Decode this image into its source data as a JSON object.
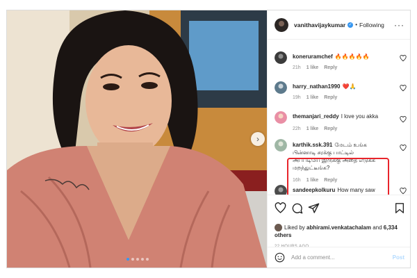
{
  "post": {
    "username": "vanithavijaykumar",
    "verified_mark": "✓",
    "separator": "•",
    "follow_status": "Following",
    "more_glyph": "···",
    "next_glyph": "›"
  },
  "comments": [
    {
      "username": "koneruramchef",
      "text": "🔥🔥🔥🔥🔥",
      "time": "21h",
      "likes": "1 like",
      "reply": "Reply"
    },
    {
      "username": "harry_nathan1990",
      "text": "❤️🙏",
      "time": "19h",
      "likes": "1 like",
      "reply": "Reply"
    },
    {
      "username": "themanjari_reddy",
      "text": "I love you akka",
      "time": "22h",
      "likes": "1 like",
      "reply": "Reply"
    },
    {
      "username": "karthik.ssk.391",
      "text": "மேடம் உங்க பின்னாடி சரக்கு பாட்டில் அப்படியே இருக்கு அதை எடுக்க மறந்துட்டீங்க?",
      "time": "16h",
      "likes": "1 like",
      "reply": "Reply"
    },
    {
      "username": "sandeepkolkuru",
      "text": "How many saw",
      "time": "",
      "likes": "",
      "reply": ""
    }
  ],
  "likes_info": {
    "prefix": "Liked by",
    "liker": "abhirami.venkatachalam",
    "and": "and",
    "others": "6,334 others"
  },
  "time_ago": "22 HOURS AGO",
  "add_comment": {
    "placeholder": "Add a comment...",
    "post_label": "Post"
  },
  "icons": {
    "like": "heart-icon",
    "comment": "comment-icon",
    "share": "share-icon",
    "save": "bookmark-icon",
    "emoji": "smiley-icon"
  },
  "colors": {
    "highlight_border": "#e8242b",
    "link_blue": "#3897f0",
    "post_disabled": "#b3dbff"
  }
}
